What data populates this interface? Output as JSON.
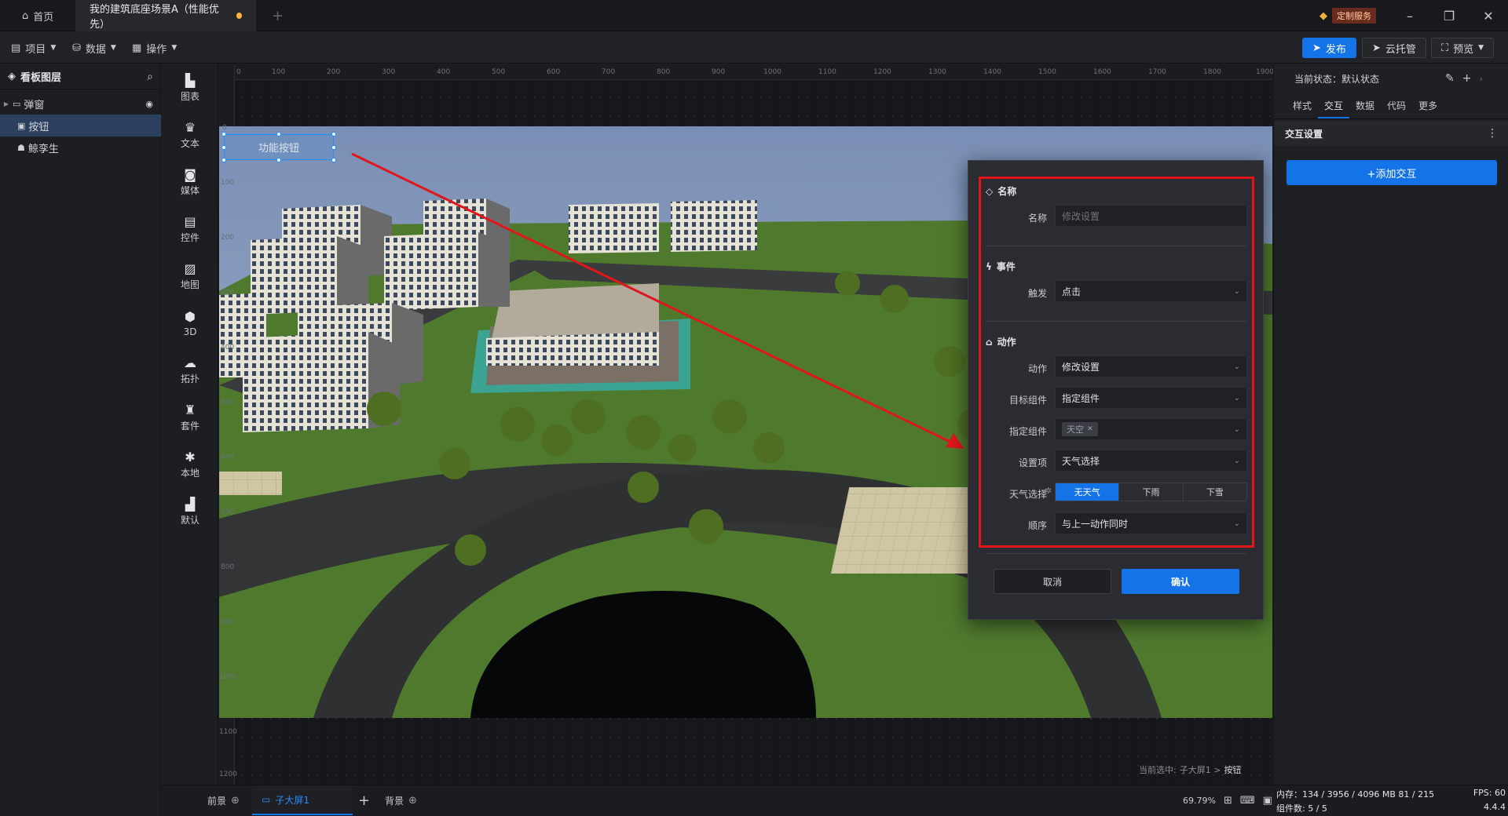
{
  "titlebar": {
    "home_tab": "首页",
    "project_tab": "我的建筑底座场景A（性能优先）",
    "custom_service": "定制服务"
  },
  "toolbar": {
    "project": "项目",
    "data": "数据",
    "operate": "操作",
    "publish": "发布",
    "cloud_host": "云托管",
    "preview": "预览"
  },
  "layers": {
    "title": "看板图层",
    "items": [
      {
        "label": "弹窗"
      },
      {
        "label": "按钮"
      },
      {
        "label": "鲸孪生"
      }
    ]
  },
  "iconbar": {
    "items": [
      {
        "label": "图表",
        "icon": "chart-icon"
      },
      {
        "label": "文本",
        "icon": "text-icon"
      },
      {
        "label": "媒体",
        "icon": "media-icon"
      },
      {
        "label": "控件",
        "icon": "control-icon"
      },
      {
        "label": "地图",
        "icon": "map-icon"
      },
      {
        "label": "3D",
        "icon": "cube-icon"
      },
      {
        "label": "拓扑",
        "icon": "topology-icon"
      },
      {
        "label": "套件",
        "icon": "shirt-icon"
      },
      {
        "label": "本地",
        "icon": "puzzle-icon"
      },
      {
        "label": "默认",
        "icon": "bar-chart-icon"
      }
    ]
  },
  "canvas": {
    "ruler_h": [
      "0",
      "100",
      "200",
      "300",
      "400",
      "500",
      "600",
      "700",
      "800",
      "900",
      "1000",
      "1100",
      "1200",
      "1300",
      "1400",
      "1500",
      "1600",
      "1700",
      "1800",
      "1900"
    ],
    "ruler_v": [
      "0",
      "100",
      "200",
      "300",
      "400",
      "500",
      "600",
      "700",
      "800",
      "900",
      "1000",
      "1100",
      "1200"
    ],
    "button_label": "功能按钮",
    "current_selection_prefix": "当前选中:",
    "current_selection_path": "子大屏1 > ",
    "current_selection_item": "按钮"
  },
  "dialog": {
    "name_section": "名称",
    "name_label": "名称",
    "name_placeholder": "修改设置",
    "event_section": "事件",
    "trigger_label": "触发",
    "trigger_value": "点击",
    "action_section": "动作",
    "action_label": "动作",
    "action_value": "修改设置",
    "target_label": "目标组件",
    "target_value": "指定组件",
    "specified_label": "指定组件",
    "specified_tag": "天空",
    "setting_label": "设置项",
    "setting_value": "天气选择",
    "weather_label": "天气选择",
    "weather_options": [
      "无天气",
      "下雨",
      "下雪"
    ],
    "order_label": "顺序",
    "order_value": "与上一动作同时",
    "cancel": "取消",
    "confirm": "确认"
  },
  "bottombar": {
    "foreground": "前景",
    "sub_screen": "子大屏1",
    "background": "背景",
    "zoom": "69.79%"
  },
  "rightpanel": {
    "current_state": "当前状态：默认状态",
    "tabs": [
      "样式",
      "交互",
      "数据",
      "代码",
      "更多"
    ],
    "active_tab": 1,
    "section_title": "交互设置",
    "add_button": "+添加交互"
  },
  "statusbar": {
    "memory": "内存：134 / 3956 / 4096 MB  81 / 215 MB",
    "fps": "FPS:  60",
    "components": "组件数: 5 / 5",
    "version": "4.4.4"
  },
  "colors": {
    "accent": "#1473e6",
    "highlight_border": "#e0161b",
    "arrow": "#e0161b"
  }
}
